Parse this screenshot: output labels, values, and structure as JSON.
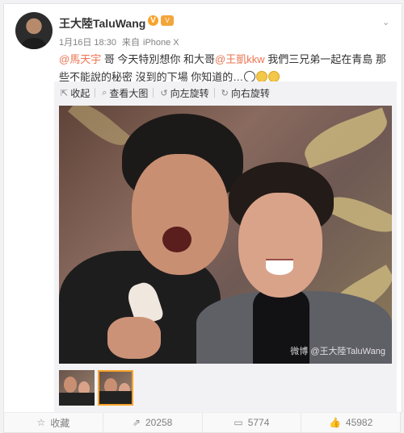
{
  "post": {
    "username": "王大陸TaluWang",
    "verified_badge": "V",
    "vip_badge": "V",
    "time": "1月16日 18:30",
    "source_prefix": "来自",
    "device": "iPhone X",
    "text": {
      "mention1": "@馬天宇",
      "part1": " 哥 今天特別想你 和大哥",
      "mention2": "@王凱kkw",
      "part2": " 我們三兄弟一起在青島 那些不能說的秘密 沒到的下場 你知道的…"
    }
  },
  "media_toolbar": {
    "collapse": "收起",
    "view_large": "查看大图",
    "rotate_left": "向左旋转",
    "rotate_right": "向右旋转"
  },
  "photo": {
    "watermark": "微博 @王大陸TaluWang"
  },
  "actions": {
    "favorite": "收藏",
    "reposts": "20258",
    "comments": "5774",
    "likes": "45982"
  },
  "colors": {
    "mention": "#eb7350",
    "verified": "#f7a32c"
  },
  "icons": {
    "favorite": "star-icon",
    "repost": "repost-icon",
    "comment": "comment-icon",
    "like": "thumbs-up-icon"
  }
}
